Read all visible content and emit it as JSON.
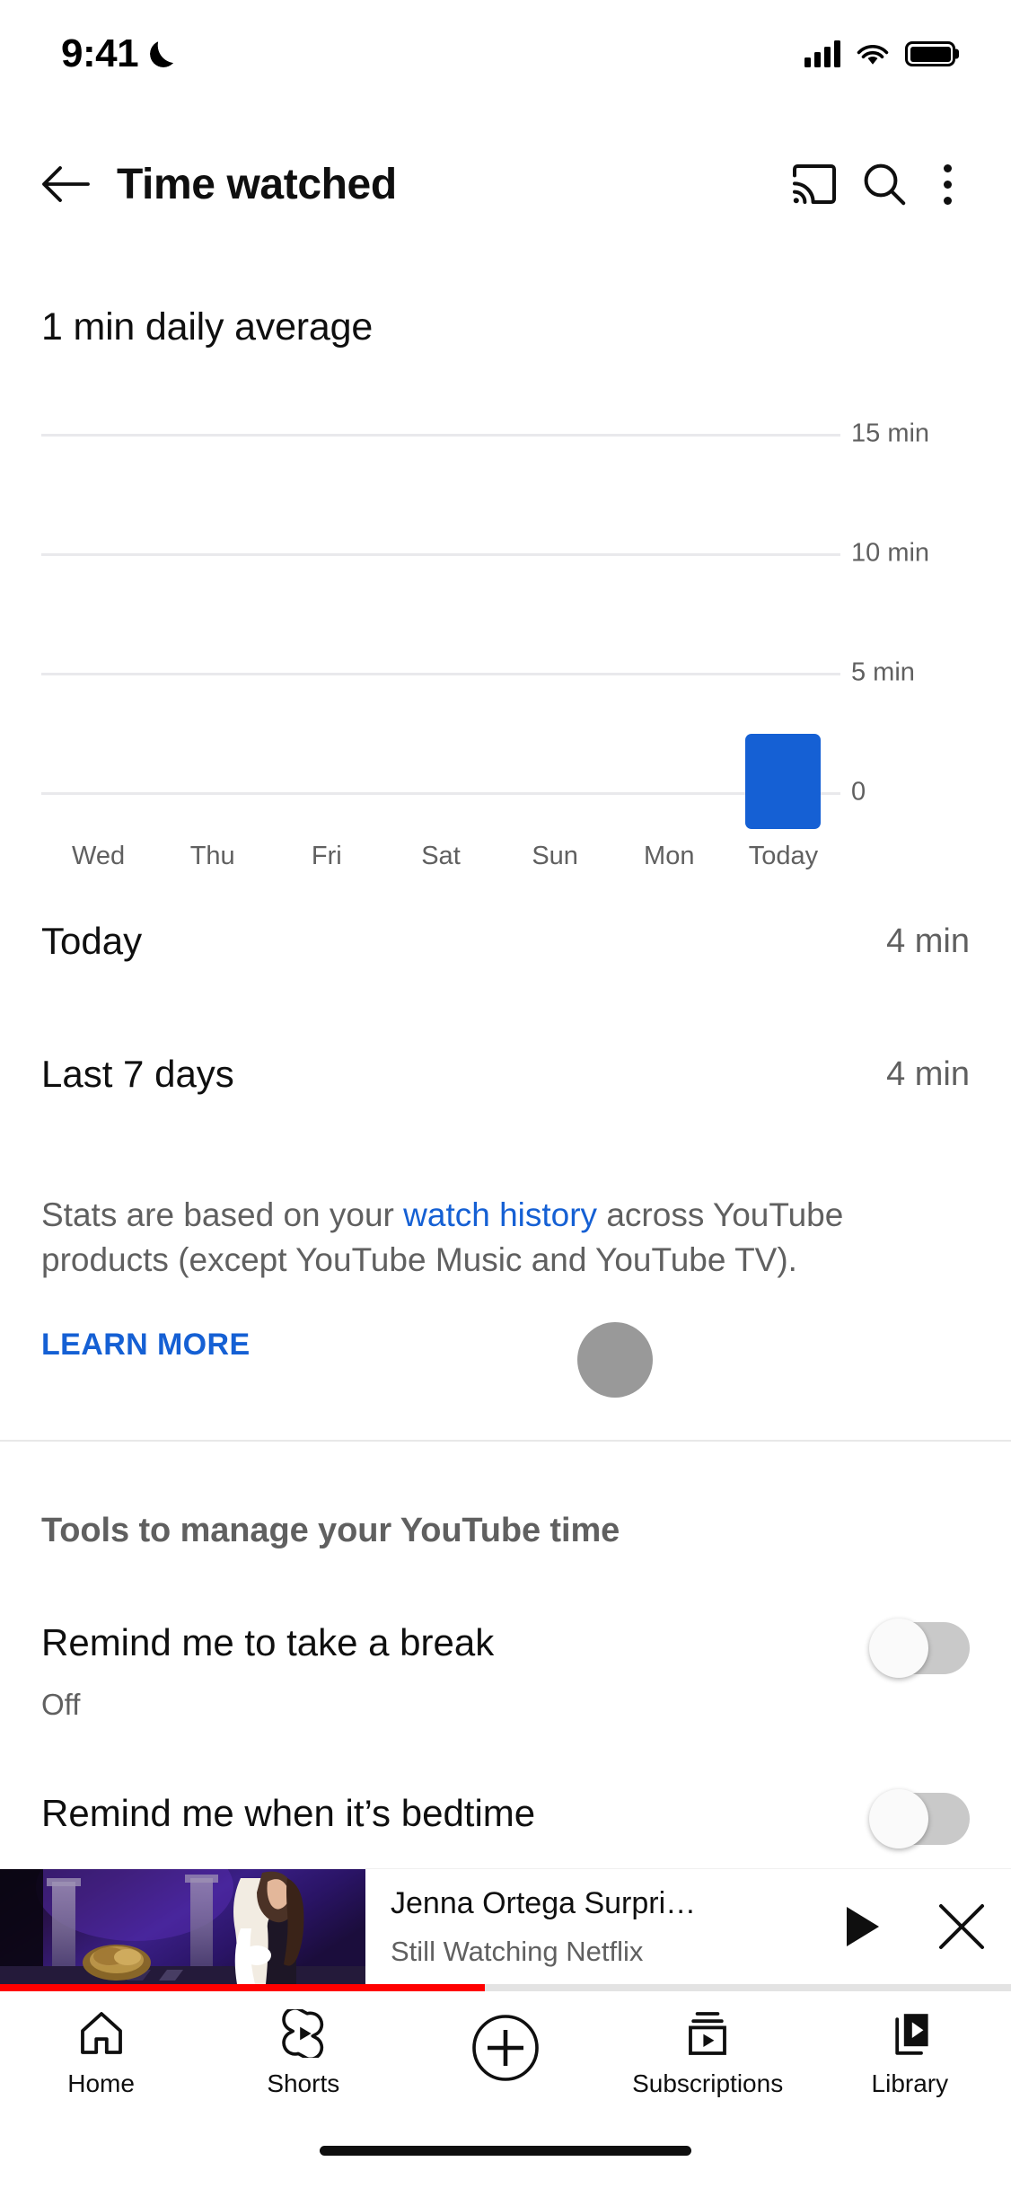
{
  "status_bar": {
    "time": "9:41",
    "dnd_icon": "crescent-moon-icon",
    "signal_icon": "cellular-signal-icon",
    "wifi_icon": "wifi-icon",
    "battery_icon": "battery-full-icon"
  },
  "app_bar": {
    "back_icon": "back-arrow-icon",
    "title": "Time watched",
    "cast_icon": "cast-icon",
    "search_icon": "search-icon",
    "overflow_icon": "more-vertical-icon"
  },
  "chart_data": {
    "type": "bar",
    "title": "1 min daily average",
    "categories": [
      "Wed",
      "Thu",
      "Fri",
      "Sat",
      "Sun",
      "Mon",
      "Today"
    ],
    "values": [
      0,
      0,
      0,
      0,
      0,
      0,
      4
    ],
    "ytick_labels": [
      "15 min",
      "10 min",
      "5 min",
      "0"
    ],
    "ytick_values": [
      15,
      10,
      5,
      0
    ],
    "ylim": [
      0,
      16.5
    ],
    "xlabel": "",
    "ylabel": "",
    "grid": true,
    "legend": false,
    "bar_color": "#1560d4",
    "gridline_color": "#e9e9ec"
  },
  "stats": [
    {
      "label": "Today",
      "value": "4 min"
    },
    {
      "label": "Last 7 days",
      "value": "4 min"
    }
  ],
  "description": {
    "part1": "Stats are based on your ",
    "link": "watch history",
    "part2": " across YouTube products (except YouTube Music and YouTube TV).",
    "learn_more": "LEARN MORE",
    "link_color": "#1560d4"
  },
  "tools": {
    "heading": "Tools to manage your YouTube time",
    "items": [
      {
        "title": "Remind me to take a break",
        "subtitle": "Off",
        "toggle_state": "off"
      },
      {
        "title": "Remind me when it’s bedtime",
        "subtitle": "",
        "toggle_state": "off"
      }
    ]
  },
  "mini_player": {
    "title": "Jenna Ortega Surpri…",
    "channel": "Still Watching Netflix",
    "play_icon": "play-icon",
    "close_icon": "close-icon",
    "progress_percent": 48,
    "progress_color": "#ff0000"
  },
  "bottom_nav": [
    {
      "label": "Home",
      "icon": "home-icon"
    },
    {
      "label": "Shorts",
      "icon": "shorts-icon"
    },
    {
      "label": "",
      "icon": "create-plus-icon"
    },
    {
      "label": "Subscriptions",
      "icon": "subscriptions-icon"
    },
    {
      "label": "Library",
      "icon": "library-icon"
    }
  ]
}
